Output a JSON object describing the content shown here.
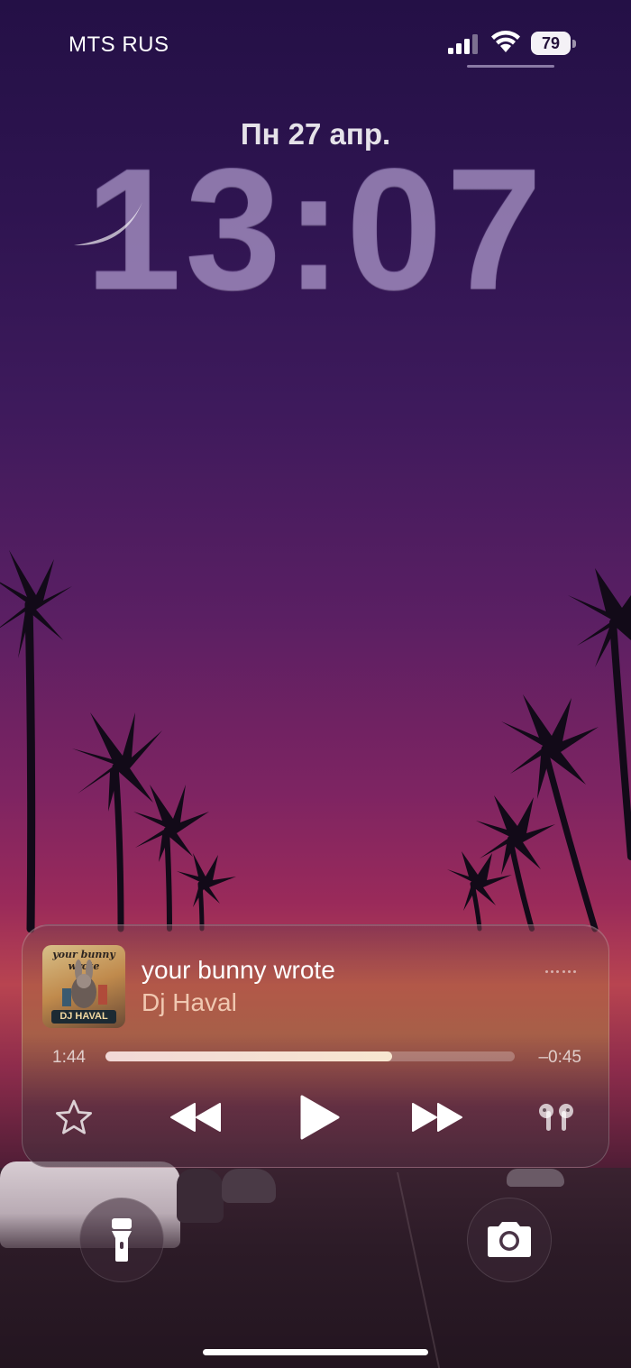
{
  "status_bar": {
    "carrier": "MTS RUS",
    "battery_level": "79",
    "icons": [
      "signal-icon",
      "wifi-icon",
      "battery-icon"
    ]
  },
  "lock_screen": {
    "date": "Пн 27 апр.",
    "time": "13:07"
  },
  "now_playing": {
    "album_art_title": "your bunny wrote",
    "album_art_label": "DJ HAVAL",
    "title": "your bunny wrote",
    "artist": "Dj Haval",
    "elapsed": "1:44",
    "remaining": "–0:45",
    "progress": 0.7,
    "controls": [
      "star-icon",
      "rewind-icon",
      "play-icon",
      "fast-forward-icon",
      "airpods-icon"
    ]
  },
  "quick_actions": [
    "flashlight-icon",
    "camera-icon"
  ],
  "colors": {
    "sky_top": "#241046",
    "sky_horizon": "#b84450",
    "clock": "#b096d6",
    "accent_artist": "#ffe1c8"
  }
}
